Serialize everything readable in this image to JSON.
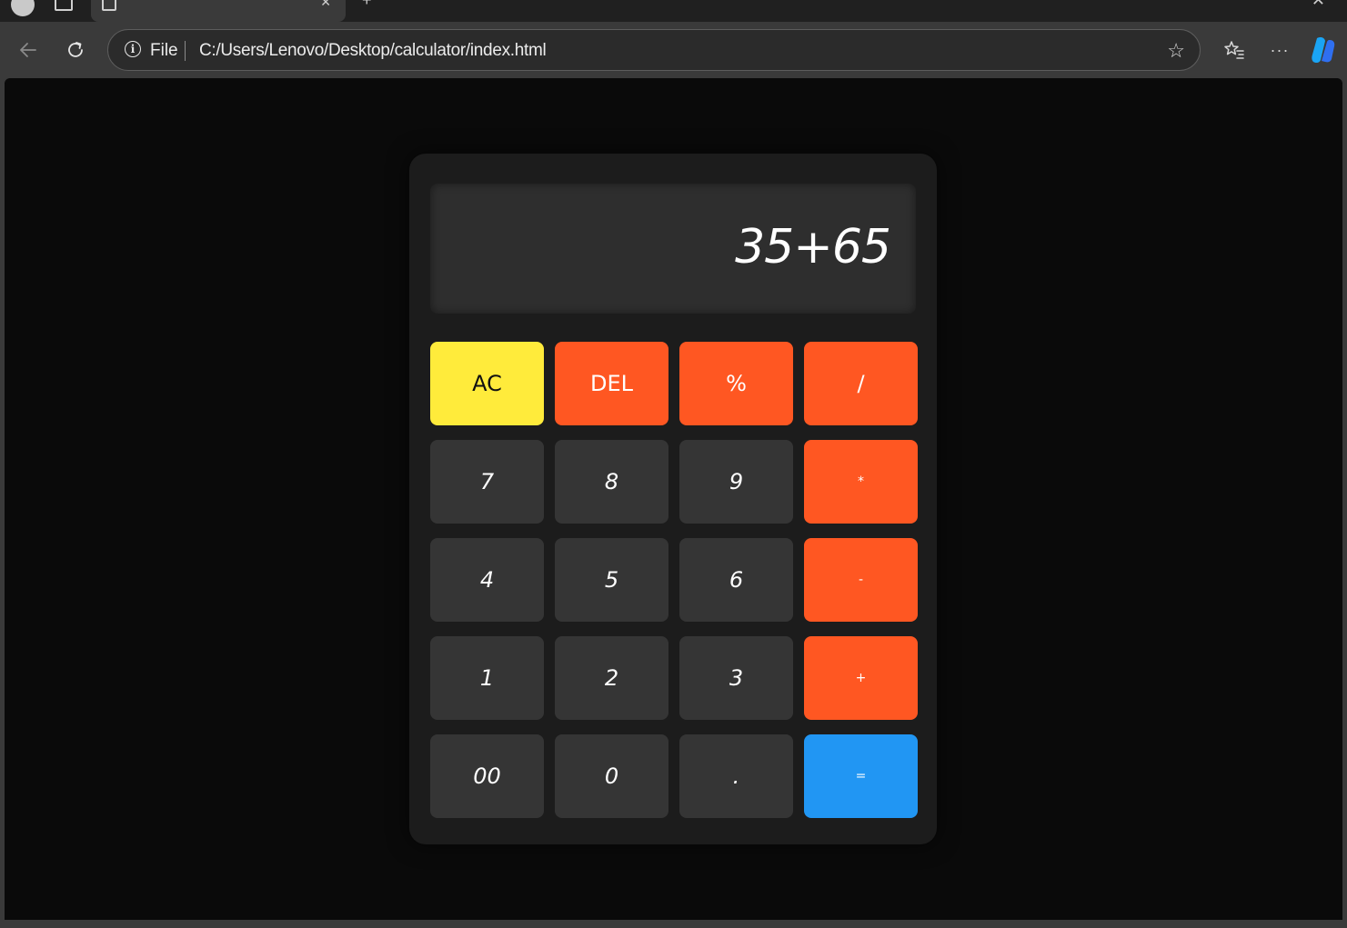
{
  "browser": {
    "site_info": "File",
    "url": "C:/Users/Lenovo/Desktop/calculator/index.html",
    "more_label": "···"
  },
  "calculator": {
    "display": "35+65",
    "keys": [
      {
        "label": "AC",
        "kind": "clear"
      },
      {
        "label": "DEL",
        "kind": "operator"
      },
      {
        "label": "%",
        "kind": "operator"
      },
      {
        "label": "/",
        "kind": "operator"
      },
      {
        "label": "7",
        "kind": "digit"
      },
      {
        "label": "8",
        "kind": "digit"
      },
      {
        "label": "9",
        "kind": "digit"
      },
      {
        "label": "*",
        "kind": "operator"
      },
      {
        "label": "4",
        "kind": "digit"
      },
      {
        "label": "5",
        "kind": "digit"
      },
      {
        "label": "6",
        "kind": "digit"
      },
      {
        "label": "-",
        "kind": "operator"
      },
      {
        "label": "1",
        "kind": "digit"
      },
      {
        "label": "2",
        "kind": "digit"
      },
      {
        "label": "3",
        "kind": "digit"
      },
      {
        "label": "+",
        "kind": "operator"
      },
      {
        "label": "00",
        "kind": "digit"
      },
      {
        "label": "0",
        "kind": "digit"
      },
      {
        "label": ".",
        "kind": "digit"
      },
      {
        "label": "=",
        "kind": "equals"
      }
    ]
  },
  "colors": {
    "clear_key": "#ffeb3b",
    "operator_key": "#ff5722",
    "equals_key": "#2196f3",
    "digit_key": "#353535",
    "calculator_body": "#1c1c1c",
    "page_background": "#0a0a0a"
  },
  "icons": [
    "profile-avatar-icon",
    "tab-actions-icon",
    "page-icon",
    "close-icon",
    "new-tab-icon",
    "minimize-icon",
    "back-arrow-icon",
    "reload-icon",
    "info-icon",
    "star-icon",
    "favorites-icon",
    "more-icon",
    "copilot-icon"
  ]
}
